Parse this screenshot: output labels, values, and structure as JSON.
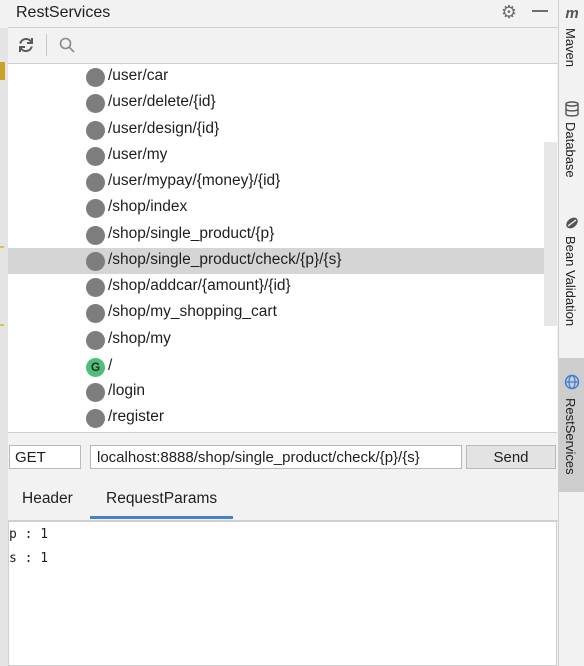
{
  "window": {
    "title": "RestServices"
  },
  "toolbar": {
    "refresh_icon": "refresh-icon",
    "search_icon": "search-icon"
  },
  "tree": {
    "items": [
      {
        "path": "/user/car",
        "method": ""
      },
      {
        "path": "/user/delete/{id}",
        "method": ""
      },
      {
        "path": "/user/design/{id}",
        "method": ""
      },
      {
        "path": "/user/my",
        "method": ""
      },
      {
        "path": "/user/mypay/{money}/{id}",
        "method": ""
      },
      {
        "path": "/shop/index",
        "method": ""
      },
      {
        "path": "/shop/single_product/{p}",
        "method": ""
      },
      {
        "path": "/shop/single_product/check/{p}/{s}",
        "method": "",
        "selected": true
      },
      {
        "path": "/shop/addcar/{amount}/{id}",
        "method": ""
      },
      {
        "path": "/shop/my_shopping_cart",
        "method": ""
      },
      {
        "path": "/shop/my",
        "method": ""
      },
      {
        "path": "/",
        "method": "G"
      },
      {
        "path": "/login",
        "method": ""
      },
      {
        "path": "/register",
        "method": ""
      }
    ]
  },
  "request": {
    "method": "GET",
    "url": "localhost:8888/shop/single_product/check/{p}/{s}",
    "send_label": "Send"
  },
  "tabs": {
    "header": "Header",
    "params": "RequestParams",
    "active": "RequestParams"
  },
  "params": {
    "lines": [
      "p : 1",
      "s : 1"
    ]
  },
  "sidebar": {
    "maven": "Maven",
    "database": "Database",
    "bean_validation": "Bean Validation",
    "rest_services": "RestServices"
  },
  "colors": {
    "selected_row": "#d5d5d5",
    "get_badge": "#4fbf78",
    "tab_underline": "#4083c9"
  }
}
